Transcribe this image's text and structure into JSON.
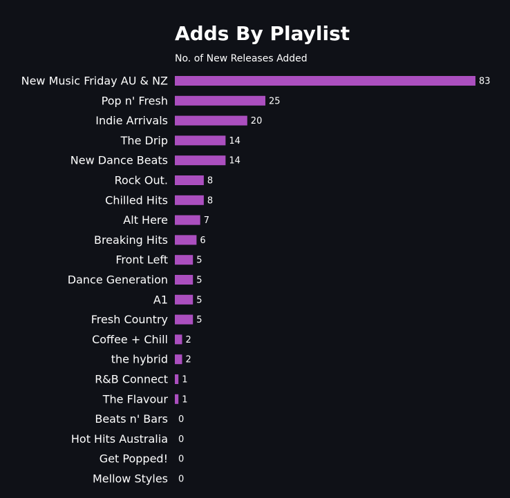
{
  "chart_data": {
    "type": "bar",
    "orientation": "horizontal",
    "title": "Adds By Playlist",
    "subtitle": "No. of New Releases Added",
    "categories": [
      "New Music Friday AU & NZ",
      "Pop n' Fresh",
      "Indie Arrivals",
      "The Drip",
      "New Dance Beats",
      "Rock Out.",
      "Chilled Hits",
      "Alt Here",
      "Breaking Hits",
      "Front Left",
      "Dance Generation",
      "A1",
      "Fresh Country",
      "Coffee + Chill",
      "the hybrid",
      "R&B Connect",
      "The Flavour",
      "Beats n' Bars",
      "Hot Hits Australia",
      "Get Popped!",
      "Mellow Styles"
    ],
    "values": [
      83,
      25,
      20,
      14,
      14,
      8,
      8,
      7,
      6,
      5,
      5,
      5,
      5,
      2,
      2,
      1,
      1,
      0,
      0,
      0,
      0
    ],
    "value_labels": [
      "83",
      "25",
      "20",
      "14",
      "14",
      "8",
      "8",
      "7",
      "6",
      "5",
      "5",
      "5",
      "5",
      "2",
      "2",
      "1",
      "1",
      "0",
      "0",
      "0",
      "0"
    ],
    "xlim": [
      0,
      83
    ],
    "grid": false,
    "bar_color": "#ab4fbf",
    "background_color": "#0f1117",
    "text_color": "#ffffff"
  }
}
